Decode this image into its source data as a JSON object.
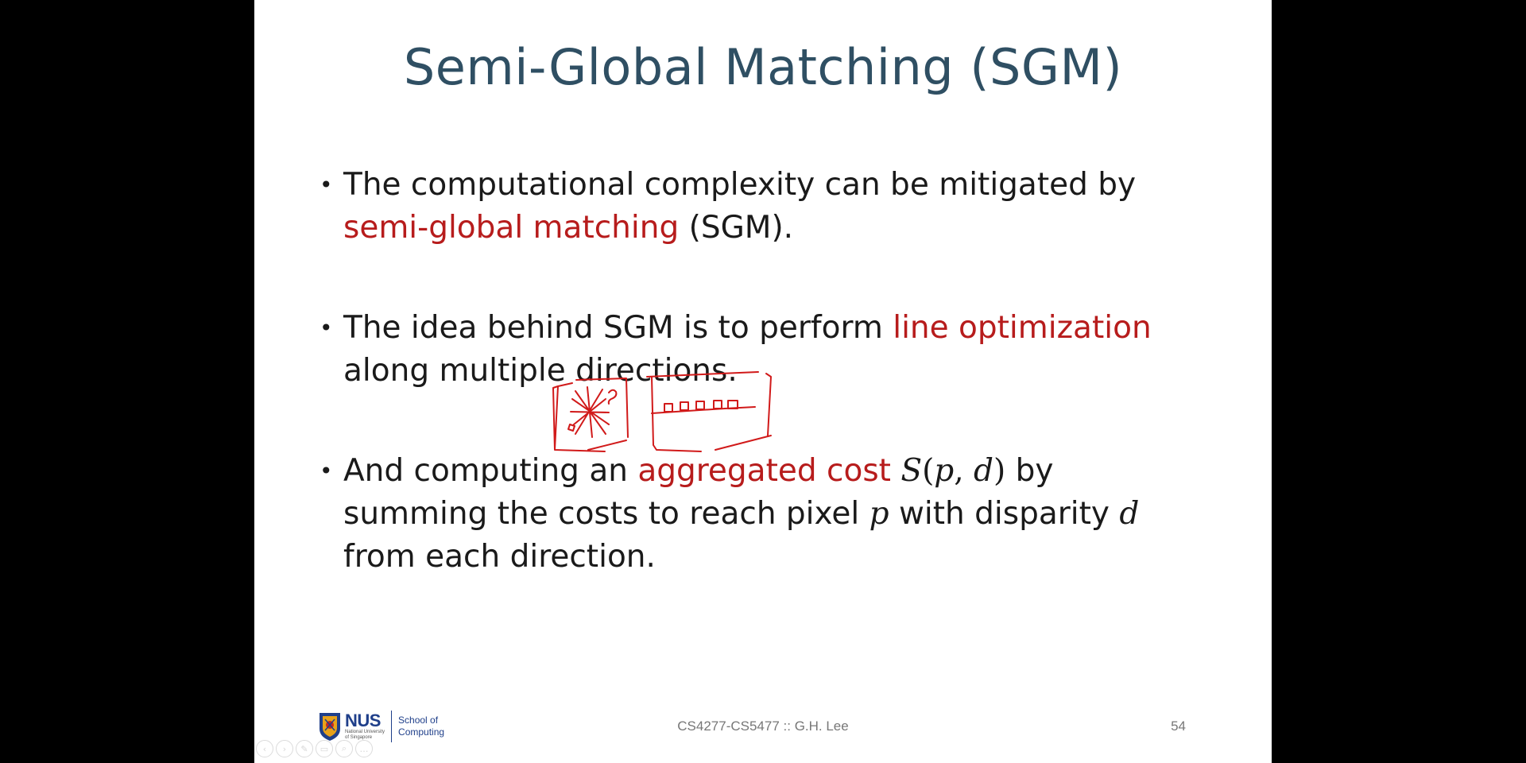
{
  "slide": {
    "title": "Semi-Global Matching (SGM)",
    "bullets": [
      {
        "line1": "The computational complexity can be mitigated by",
        "highlight": "semi-global matching",
        "tail": "(SGM)."
      },
      {
        "lead": "The idea behind SGM is to perform",
        "highlight": "line optimization",
        "line2": "along multiple directions."
      },
      {
        "lead": "And computing an",
        "highlight": "aggregated cost",
        "math_S": "S",
        "math_open": "(",
        "math_p": "p",
        "math_comma": ", ",
        "math_d": "d",
        "math_close": ")",
        "after_math": "by",
        "line2_a": "summing the costs to reach pixel",
        "line2_p": "p",
        "line2_b": "with disparity",
        "line2_d": "d",
        "line3": "from each direction."
      }
    ]
  },
  "footer": {
    "logo_word": "NUS",
    "logo_sub_1": "National University",
    "logo_sub_2": "of Singapore",
    "school_line1": "School of",
    "school_line2": "Computing",
    "course": "CS4277-CS5477 :: G.H. Lee",
    "page": "54"
  },
  "colors": {
    "title": "#2f4f63",
    "highlight": "#b71c1c",
    "ink": "#d11a1a",
    "nus_blue": "#1f3f8a"
  },
  "toolbar": {
    "icons": [
      "prev-icon",
      "next-icon",
      "pen-icon",
      "slides-icon",
      "zoom-icon",
      "more-icon"
    ],
    "glyphs": [
      "‹",
      "›",
      "✎",
      "▭",
      "⌕",
      "…"
    ]
  }
}
